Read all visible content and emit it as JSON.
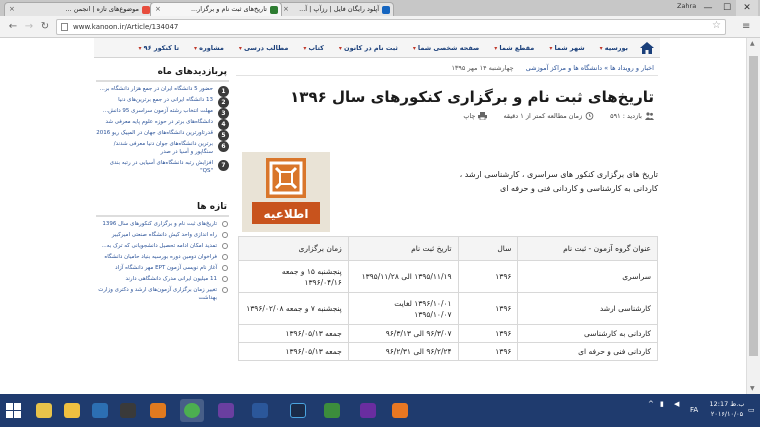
{
  "browser": {
    "tabs": [
      {
        "title": "موضوع‌های تازه | انجمن ..."
      },
      {
        "title": "تاریخ‌های ثبت نام و برگزار..."
      },
      {
        "title": "آپلود رایگان فایل | رزآپ | آ..."
      }
    ],
    "user": "Zahra",
    "url": "www.kanoon.ir/Article/134047",
    "close_glyph": "×",
    "min_glyph": "—",
    "max_glyph": "☐",
    "close_win_glyph": "✕"
  },
  "nav": {
    "items": [
      "بورسیه",
      "شهر شما",
      "مقطع شما",
      "صفحه شخصی شما",
      "ثبت نام در کانون",
      "کتاب",
      "مطالب درسی",
      "مشاوره",
      "تا کنکور ۹۶"
    ]
  },
  "article": {
    "breadcrumb": "اخبار و رویداد ها  »  دانشگاه ها و مراکز آموزشی",
    "date": "چهارشنبه ۱۴ مهر ۱۳۹۵",
    "title": "تاریخ‌های ثبت نام و برگزاری کنکورهای سال ۱۳۹۶",
    "views_label": "بازدید : ۵۹۱",
    "read_time": "زمان مطالعه کمتر از ۱ دقیقه",
    "print": "چاپ",
    "intro": "تاریخ‌ های برگزاری کنکور های سراسری ، کارشناسی ارشد ، کاردانی به کارشناسی  و کاردانی فنی و حرفه ای",
    "notice_text": "اطلاعیه"
  },
  "table": {
    "headers": [
      "عنوان گروه آزمون - ثبت نام",
      "سال",
      "تاریخ ثبت نام",
      "زمان برگزاری"
    ],
    "rows": [
      {
        "title": "سراسری",
        "year": "۱۳۹۶",
        "reg": "۱۳۹۵/۱۱/۱۹ الی ۱۳۹۵/۱۱/۲۸",
        "exam": "پنجشنبه ۱۵ و جمعه ۱۳۹۶/۰۴/۱۶"
      },
      {
        "title": "کارشناسی ارشد",
        "year": "۱۳۹۶",
        "reg": "۱۳۹۶/۱۰/۰۱ لغایت ۱۳۹۵/۱۰/۰۷",
        "exam": "پنجشنبه ۷ و جمعه ۱۳۹۶/۰۲/۰۸"
      },
      {
        "title": "کاردانی به کارشناسی",
        "year": "۱۳۹۶",
        "reg": "۹۶/۳/۰۷ الی ۹۶/۳/۱۳",
        "exam": "جمعه ۱۳۹۶/۰۵/۱۳"
      },
      {
        "title": "کاردانی فنی و حرفه ای",
        "year": "۱۳۹۶",
        "reg": "۹۶/۲/۲۴ الی ۹۶/۲/۳۱",
        "exam": "جمعه ۱۳۹۶/۰۵/۱۳"
      }
    ]
  },
  "sidebar": {
    "popular_title": "پربازدیدهای ماه",
    "popular": [
      {
        "num": "1",
        "text": "حضور 5 دانشگاه ایران در جمع هزار دانشگاه بر..."
      },
      {
        "num": "2",
        "text": "13 دانشگاه ایرانی در جمع برترین‌های دنیا"
      },
      {
        "num": "3",
        "text": "مهلت انتخاب رشته آزمون سراسری 95 دانش..."
      },
      {
        "num": "4",
        "text": "دانشگاه‌های برتر در حوزه علوم پایه معرفی شد"
      },
      {
        "num": "5",
        "text": "قدرتاورترین دانشگاه‌های جهان در المپیک ریو 2016"
      },
      {
        "num": "6",
        "text": "برترین دانشگاه‌های جوان دنیا معرفی شدند/ سنگاپور و آسیا در صدر"
      },
      {
        "num": "7",
        "text": "افزایش رتبه دانشگاه‌های آسیایی در رتبه بندی \"QS\""
      }
    ],
    "new_title": "تازه ها",
    "new_items": [
      "تاریخ‌های ثبت نام و برگزاری کنکورهای سال 1396",
      "راه اندازی واحد کیش دانشگاه صنعتی امیرکبیر",
      "تمدید امکان ادامه تحصیل دانشجویانی که ترک به...",
      "فراخوان دومین دوره بورسیه بنیاد حامیان دانشگاه",
      "آغاز نام نویسی آزمون EPT مهر دانشگاه آزاد",
      "11 میلیون ایرانی مدرک دانشگاهی دارند",
      "تغییر زمان برگزاری آزمون‌های ارشد و دکتری وزارت بهداشت"
    ]
  },
  "taskbar": {
    "lang": "FA",
    "time": "ب.ظ 12:17",
    "date": "۲۰۱۶/۱۰/۰۵"
  }
}
